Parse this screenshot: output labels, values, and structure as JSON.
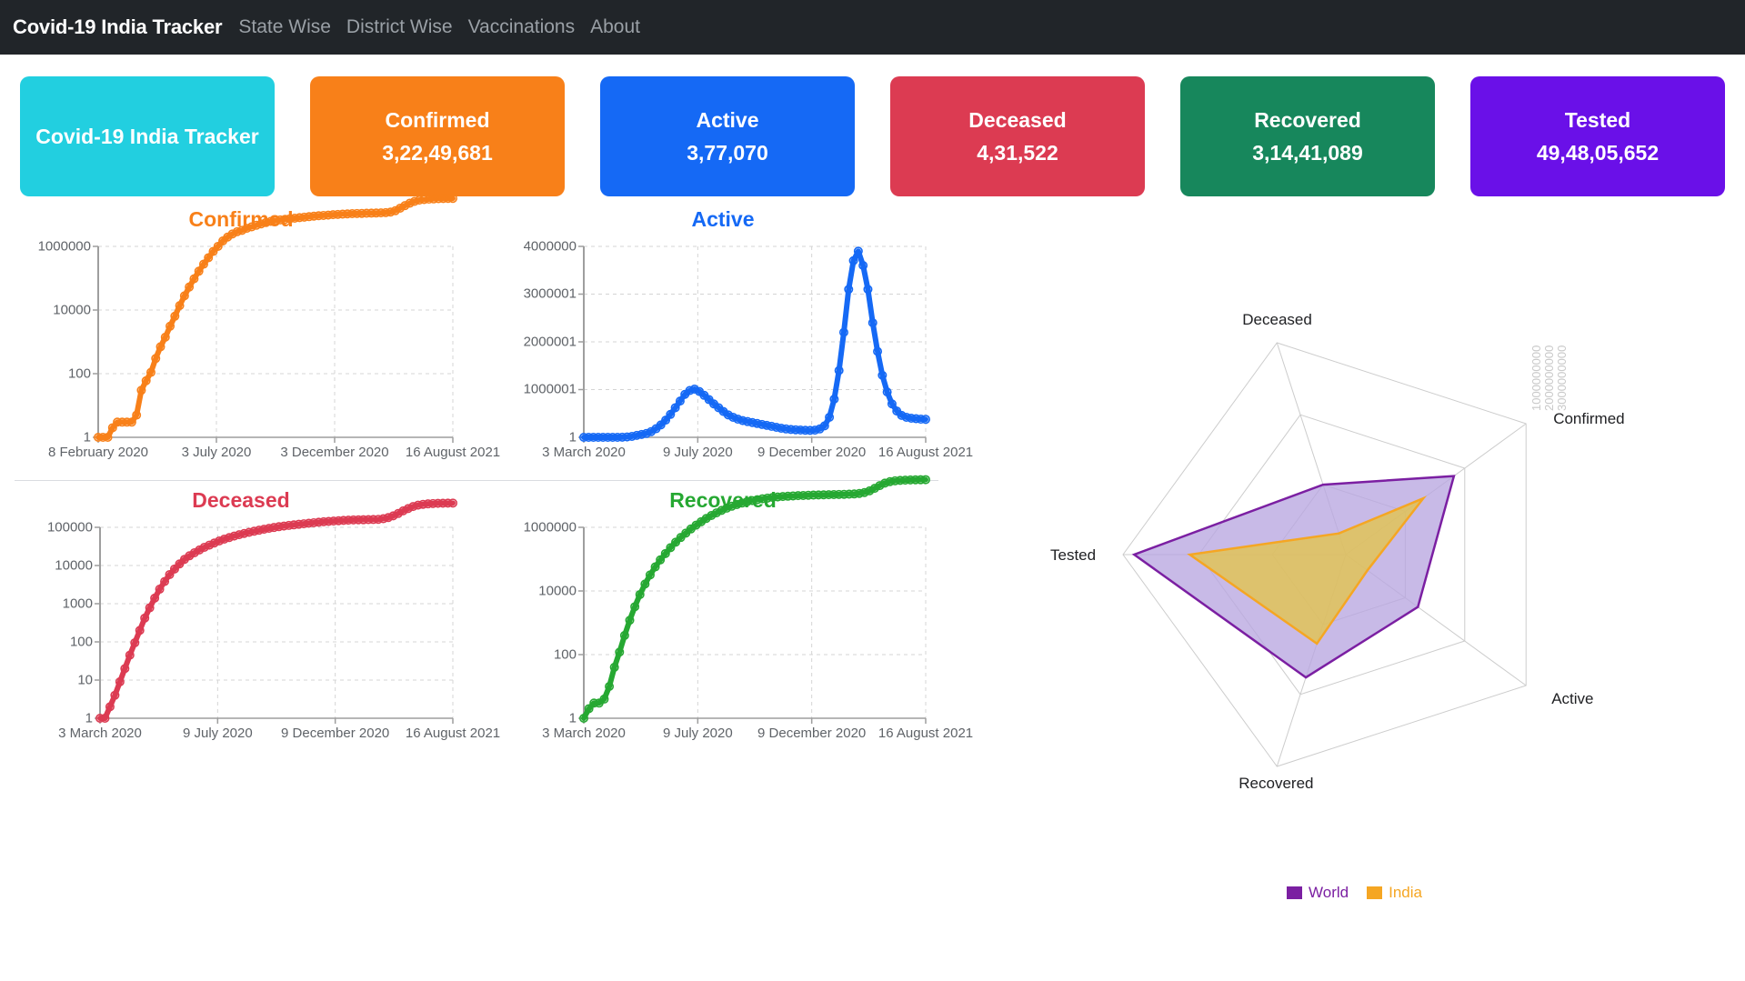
{
  "navbar": {
    "brand": "Covid-19 India Tracker",
    "links": [
      {
        "label": "State Wise"
      },
      {
        "label": "District Wise"
      },
      {
        "label": "Vaccinations"
      },
      {
        "label": "About"
      }
    ]
  },
  "cards": [
    {
      "title": "Covid-19 India Tracker",
      "value": "",
      "color": "#22cfe0"
    },
    {
      "title": "Confirmed",
      "value": "3,22,49,681",
      "color": "#f88019"
    },
    {
      "title": "Active",
      "value": "3,77,070",
      "color": "#1569f5"
    },
    {
      "title": "Deceased",
      "value": "4,31,522",
      "color": "#dc3b52"
    },
    {
      "title": "Recovered",
      "value": "3,14,41,089",
      "color": "#17875c"
    },
    {
      "title": "Tested",
      "value": "49,48,05,652",
      "color": "#6a10e8"
    }
  ],
  "chart_data": [
    {
      "type": "line",
      "title": "Confirmed",
      "color": "#f88019",
      "xlabel": "",
      "ylabel": "",
      "yscale": "log",
      "yticks": [
        "1",
        "100",
        "10000",
        "1000000"
      ],
      "ytick_values": [
        1,
        100,
        10000,
        1000000
      ],
      "xticks": [
        "8 February 2020",
        "3 July 2020",
        "3 December 2020",
        "16 August 2021"
      ],
      "grid": true,
      "series": [
        {
          "name": "Confirmed",
          "values": [
            1,
            1,
            1,
            2,
            3,
            3,
            3,
            3,
            5,
            30,
            60,
            110,
            300,
            700,
            1400,
            3100,
            6400,
            13800,
            27900,
            52900,
            96100,
            165800,
            276100,
            440200,
            697400,
            1003800,
            1483200,
            1964500,
            2460000,
            2900000,
            3200000,
            3700000,
            4100000,
            4600000,
            5100000,
            5600000,
            6100000,
            6400000,
            6800000,
            7100000,
            7400000,
            7700000,
            8000000,
            8300000,
            8600000,
            8900000,
            9200000,
            9400000,
            9600000,
            9900000,
            10100000,
            10300000,
            10500000,
            10700000,
            10800000,
            10900000,
            11000000,
            11100000,
            11200000,
            11300000,
            11500000,
            12000000,
            13200000,
            15900000,
            19100000,
            22700000,
            26000000,
            28500000,
            29700000,
            30500000,
            31000000,
            31500000,
            31900000,
            32200000,
            32249681
          ]
        }
      ]
    },
    {
      "type": "line",
      "title": "Active",
      "color": "#1569f5",
      "xlabel": "",
      "ylabel": "",
      "yscale": "linear",
      "yticks": [
        "1",
        "1000001",
        "2000001",
        "3000001",
        "4000000"
      ],
      "ytick_values": [
        1,
        1000001,
        2000001,
        3000001,
        4000000
      ],
      "xticks": [
        "3 March 2020",
        "9 July 2020",
        "9 December 2020",
        "16 August 2021"
      ],
      "grid": true,
      "series": [
        {
          "name": "Active",
          "values": [
            1,
            1,
            2,
            3,
            5,
            20,
            100,
            600,
            2000,
            7000,
            19000,
            40000,
            60000,
            80000,
            120000,
            180000,
            260000,
            360000,
            480000,
            620000,
            760000,
            900000,
            980000,
            1010000,
            960000,
            880000,
            790000,
            700000,
            620000,
            540000,
            470000,
            420000,
            380000,
            350000,
            330000,
            310000,
            290000,
            270000,
            250000,
            230000,
            210000,
            190000,
            175000,
            165000,
            158000,
            152000,
            148000,
            145000,
            150000,
            175000,
            240000,
            420000,
            800000,
            1400000,
            2200000,
            3100000,
            3700000,
            3900000,
            3600000,
            3100000,
            2400000,
            1800000,
            1300000,
            950000,
            700000,
            550000,
            460000,
            420000,
            400000,
            390000,
            380000,
            377070
          ]
        }
      ]
    },
    {
      "type": "line",
      "title": "Deceased",
      "color": "#dc3b52",
      "xlabel": "",
      "ylabel": "",
      "yscale": "log",
      "yticks": [
        "1",
        "10",
        "100",
        "1000",
        "10000",
        "100000"
      ],
      "ytick_values": [
        1,
        10,
        100,
        1000,
        10000,
        100000
      ],
      "xticks": [
        "3 March 2020",
        "9 July 2020",
        "9 December 2020",
        "16 August 2021"
      ],
      "grid": true,
      "series": [
        {
          "name": "Deceased",
          "values": [
            1,
            1,
            2,
            4,
            9,
            20,
            45,
            95,
            200,
            420,
            780,
            1400,
            2400,
            3800,
            5800,
            8100,
            11000,
            14500,
            18000,
            21600,
            25600,
            30000,
            34200,
            38900,
            44000,
            49000,
            54000,
            59000,
            64000,
            69000,
            74000,
            79000,
            84000,
            89000,
            94000,
            99000,
            104000,
            108000,
            112000,
            116000,
            120000,
            124000,
            128000,
            132000,
            136000,
            140000,
            143000,
            146000,
            149000,
            152000,
            154000,
            156000,
            157000,
            158000,
            159000,
            160000,
            162000,
            168000,
            180000,
            200000,
            230000,
            270000,
            310000,
            350000,
            380000,
            400000,
            412000,
            420000,
            425000,
            428000,
            430000,
            431522
          ]
        }
      ]
    },
    {
      "type": "line",
      "title": "Recovered",
      "color": "#26a832",
      "xlabel": "",
      "ylabel": "",
      "yscale": "log",
      "yticks": [
        "1",
        "100",
        "10000",
        "1000000"
      ],
      "ytick_values": [
        1,
        100,
        10000,
        1000000
      ],
      "xticks": [
        "3 March 2020",
        "9 July 2020",
        "9 December 2020",
        "16 August 2021"
      ],
      "grid": true,
      "series": [
        {
          "name": "Recovered",
          "values": [
            1,
            2,
            3,
            3,
            4,
            10,
            40,
            120,
            400,
            1200,
            3200,
            7700,
            16500,
            32000,
            57000,
            95000,
            150000,
            230000,
            340000,
            480000,
            660000,
            890000,
            1170000,
            1500000,
            1900000,
            2350000,
            2850000,
            3400000,
            4000000,
            4600000,
            5200000,
            5800000,
            6400000,
            6900000,
            7400000,
            7900000,
            8300000,
            8700000,
            9000000,
            9300000,
            9500000,
            9700000,
            9900000,
            10000000,
            10200000,
            10300000,
            10400000,
            10500000,
            10600000,
            10700000,
            10800000,
            10900000,
            11000000,
            11200000,
            11600000,
            12400000,
            14000000,
            16800000,
            20500000,
            24500000,
            27300000,
            29000000,
            29900000,
            30400000,
            30800000,
            31100000,
            31300000,
            31441089
          ]
        }
      ]
    },
    {
      "type": "radar",
      "title": "",
      "axes": [
        "Confirmed",
        "Active",
        "Recovered",
        "Tested",
        "Deceased"
      ],
      "scale_labels": [
        "1000000000",
        "2000000000",
        "3000000000"
      ],
      "series": [
        {
          "name": "World",
          "color": "#7b1fa2",
          "fill": "#b9a7e0",
          "values": [
            0.6,
            0.4,
            0.58,
            0.95,
            0.33
          ]
        },
        {
          "name": "India",
          "color": "#f5a623",
          "fill": "#e3c44a",
          "values": [
            0.43,
            0.12,
            0.42,
            0.7,
            0.1
          ]
        }
      ],
      "legend": {
        "position": "bottom",
        "entries": [
          "World",
          "India"
        ]
      }
    }
  ]
}
